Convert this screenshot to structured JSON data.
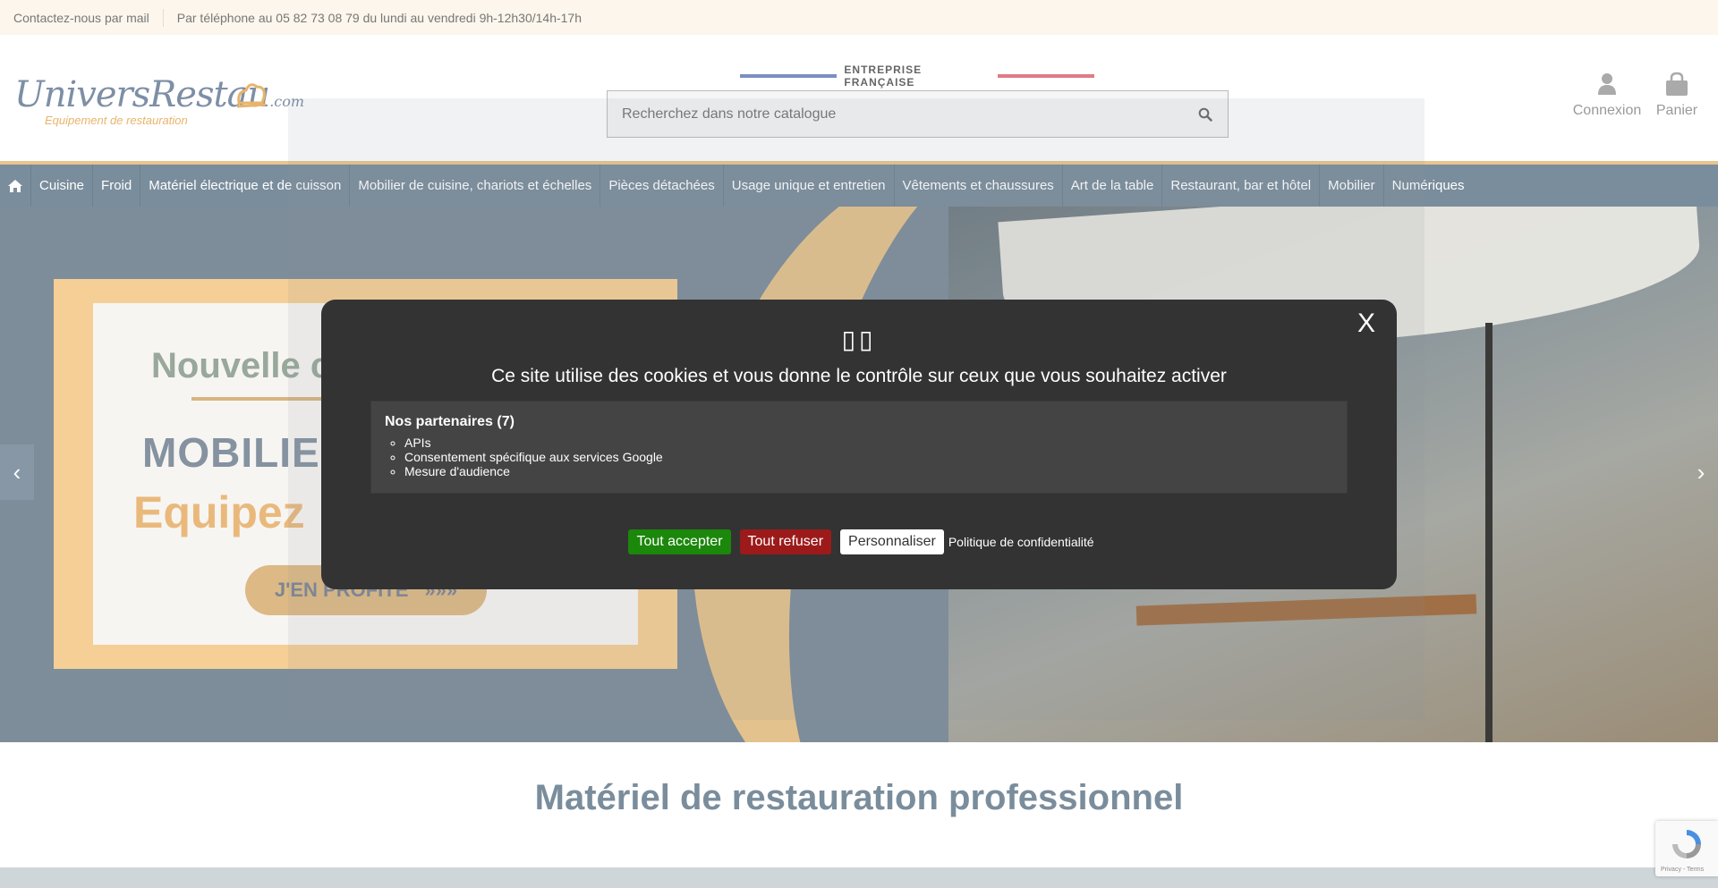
{
  "topbar": {
    "contact_mail": "Contactez-nous par mail",
    "contact_phone": "Par téléphone au 05 82 73 08 79 du lundi au vendredi 9h-12h30/14h-17h"
  },
  "header": {
    "logo_main": "UniversRestau",
    "logo_com": ".com",
    "logo_sub": "Equipement de restauration",
    "tagline": "ENTREPRISE FRANÇAISE",
    "search_placeholder": "Recherchez dans notre catalogue",
    "account_label": "Connexion",
    "cart_label": "Panier"
  },
  "nav": {
    "items": [
      "Cuisine",
      "Froid",
      "Matériel électrique et de cuisson",
      "Mobilier de cuisine, chariots et échelles",
      "Pièces détachées",
      "Usage unique et entretien",
      "Vêtements et chaussures",
      "Art de la table",
      "Restaurant, bar et hôtel",
      "Mobilier",
      "Numériques"
    ]
  },
  "hero": {
    "line1": "Nouvelle c",
    "line2": "MOBILIE",
    "line3": "Equipez",
    "cta": "J'EN PROFITE",
    "cta_arrows": "»»»",
    "prev": "‹",
    "next": "›"
  },
  "section": {
    "title": "Matériel de restauration professionnel"
  },
  "cookie_modal": {
    "close": "X",
    "emoji": "▯▯",
    "title": "Ce site utilise des cookies et vous donne le contrôle sur ceux que vous souhaitez activer",
    "partners_title": "Nos partenaires (7)",
    "partners": [
      "APIs",
      "Consentement spécifique aux services Google",
      "Mesure d'audience"
    ],
    "accept": "Tout accepter",
    "deny": "Tout refuser",
    "customize": "Personnaliser",
    "policy": "Politique de confidentialité"
  },
  "recaptcha": {
    "links": "Privacy - Terms"
  },
  "colors": {
    "nav_bg": "#7a8d9c",
    "accent_gold": "#e9c58e",
    "accept_green": "#1b870b",
    "deny_red": "#9c1a1a",
    "modal_bg": "#333333"
  }
}
